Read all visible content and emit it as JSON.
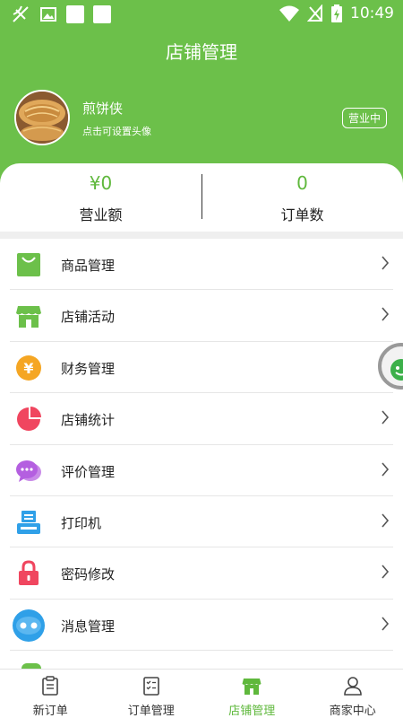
{
  "status_bar": {
    "time": "10:49"
  },
  "header": {
    "title": "店铺管理"
  },
  "profile": {
    "shop_name": "煎饼侠",
    "avatar_hint": "点击可设置头像",
    "status": "营业中"
  },
  "stats": [
    {
      "value": "¥0",
      "label": "营业额"
    },
    {
      "value": "0",
      "label": "订单数"
    }
  ],
  "menu": [
    {
      "label": "商品管理",
      "icon": "shopping-bag-icon",
      "color": "#6cc04a"
    },
    {
      "label": "店铺活动",
      "icon": "store-icon",
      "color": "#6cc04a"
    },
    {
      "label": "财务管理",
      "icon": "yuan-coin-icon",
      "color": "#f5a623"
    },
    {
      "label": "店铺统计",
      "icon": "pie-chart-icon",
      "color": "#f0465f"
    },
    {
      "label": "评价管理",
      "icon": "chat-bubble-icon",
      "color": "#b45fe0"
    },
    {
      "label": "打印机",
      "icon": "printer-icon",
      "color": "#2fa0e8"
    },
    {
      "label": "密码修改",
      "icon": "lock-icon",
      "color": "#f0465f"
    },
    {
      "label": "消息管理",
      "icon": "message-icon",
      "color": "#2fa0e8"
    }
  ],
  "tabs": [
    {
      "label": "新订单",
      "icon": "clipboard-icon",
      "active": false
    },
    {
      "label": "订单管理",
      "icon": "checklist-icon",
      "active": false
    },
    {
      "label": "店铺管理",
      "icon": "store-icon",
      "active": true
    },
    {
      "label": "商家中心",
      "icon": "user-icon",
      "active": false
    }
  ],
  "colors": {
    "brand_green": "#6cc04a",
    "divider": "#e6e6e6"
  }
}
